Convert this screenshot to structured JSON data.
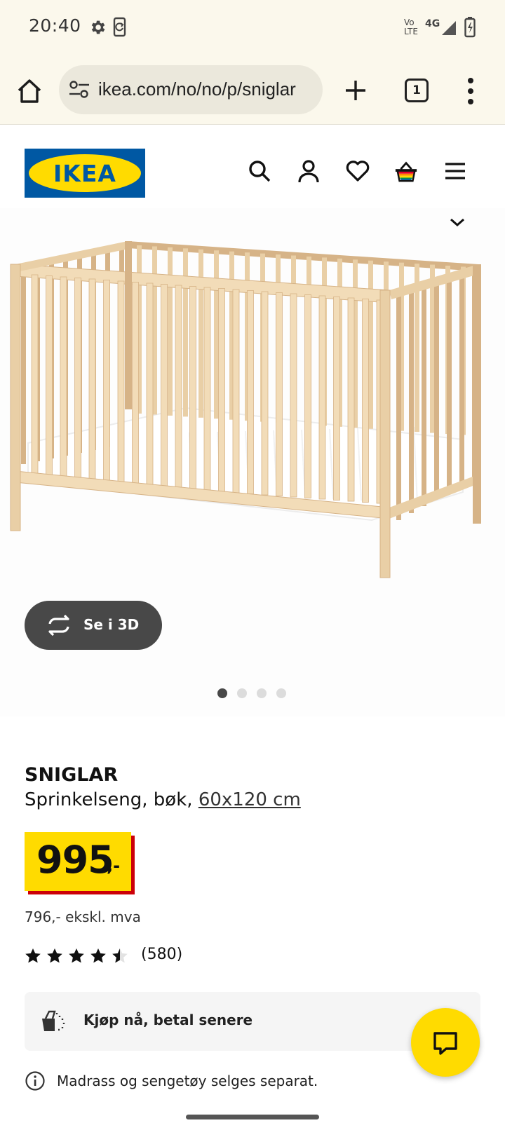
{
  "status_bar": {
    "time": "20:40",
    "network_top": "Vo",
    "network_bottom": "LTE",
    "network_type": "4G",
    "icons": [
      "gear-icon",
      "phone-sync-icon",
      "signal-icon",
      "battery-charging-icon"
    ]
  },
  "browser": {
    "url": "ikea.com/no/no/p/sniglar",
    "tab_count": "1",
    "icons": [
      "home-icon",
      "site-settings-icon",
      "plus-icon",
      "tabs-icon",
      "more-vert-icon"
    ]
  },
  "header": {
    "logo_text": "IKEA",
    "icons": [
      "search-icon",
      "account-icon",
      "heart-icon",
      "basket-icon",
      "menu-icon"
    ]
  },
  "gallery": {
    "view_3d_label": "Se i 3D",
    "image_count": 4,
    "active_image": 1
  },
  "product": {
    "name": "SNIGLAR",
    "description": "Sprinkelseng, bøk, ",
    "size": "60x120 cm",
    "price": "995",
    "price_suffix": ",-",
    "price_ex_vat": "796,- ekskl. mva",
    "rating_value": 4.5,
    "rating_max": 5,
    "review_count": "(580)",
    "bnpl_label": "Kjøp nå, betal senere",
    "note": "Madrass og sengetøy selges separat."
  },
  "colors": {
    "ikea_blue": "#0058a3",
    "ikea_yellow": "#ffdb00",
    "price_shadow": "#cc0008",
    "browser_bg": "#fbf8ec"
  }
}
